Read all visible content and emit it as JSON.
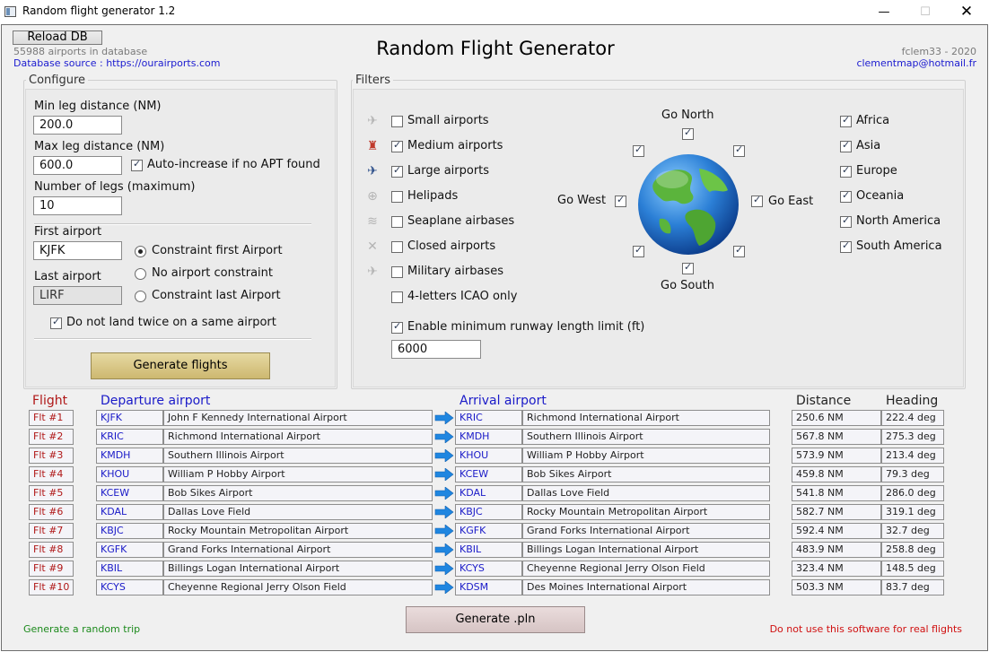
{
  "window": {
    "title": "Random flight generator 1.2",
    "minimize": "—",
    "maximize": "☐",
    "close": "✕"
  },
  "header": {
    "reload_label": "Reload DB",
    "airports_count": "55988 airports in database",
    "db_source": "Database source : https://ourairports.com",
    "app_title": "Random Flight Generator",
    "author": "fclem33 - 2020",
    "email": "clementmap@hotmail.fr"
  },
  "configure": {
    "title": "Configure",
    "min_leg_label": "Min leg distance (NM)",
    "min_leg_value": "200.0",
    "max_leg_label": "Max leg distance (NM)",
    "max_leg_value": "600.0",
    "auto_increase_label": "Auto-increase if no APT found",
    "legs_label": "Number of legs (maximum)",
    "legs_value": "10",
    "first_airport_label": "First airport",
    "first_airport_value": "KJFK",
    "last_airport_label": "Last airport",
    "last_airport_value": "LIRF",
    "radio_first": "Constraint first Airport",
    "radio_none": "No airport constraint",
    "radio_last": "Constraint last Airport",
    "no_twice_label": "Do not land twice on a same airport",
    "generate_label": "Generate flights"
  },
  "filters": {
    "title": "Filters",
    "types": [
      {
        "label": "Small airports",
        "checked": false,
        "icon": "small-airport-icon"
      },
      {
        "label": "Medium airports",
        "checked": true,
        "icon": "medium-airport-icon"
      },
      {
        "label": "Large airports",
        "checked": true,
        "icon": "large-airport-icon"
      },
      {
        "label": "Helipads",
        "checked": false,
        "icon": "helipad-icon"
      },
      {
        "label": "Seaplane airbases",
        "checked": false,
        "icon": "seaplane-icon"
      },
      {
        "label": "Closed airports",
        "checked": false,
        "icon": "closed-icon"
      },
      {
        "label": "Military airbases",
        "checked": false,
        "icon": "military-icon"
      }
    ],
    "icao_label": "4-letters ICAO only",
    "runway_label": "Enable minimum runway length limit (ft)",
    "runway_value": "6000",
    "go_north": "Go North",
    "go_south": "Go South",
    "go_east": "Go East",
    "go_west": "Go West",
    "continents": [
      {
        "label": "Africa",
        "checked": true
      },
      {
        "label": "Asia",
        "checked": true
      },
      {
        "label": "Europe",
        "checked": true
      },
      {
        "label": "Oceania",
        "checked": true
      },
      {
        "label": "North America",
        "checked": true
      },
      {
        "label": "South America",
        "checked": true
      }
    ]
  },
  "table": {
    "col_flight": "Flight",
    "col_departure": "Departure airport",
    "col_arrival": "Arrival airport",
    "col_distance": "Distance",
    "col_heading": "Heading",
    "rows": [
      {
        "flt": "Flt #1",
        "dep_icao": "KJFK",
        "dep_name": "John F Kennedy International Airport",
        "arr_icao": "KRIC",
        "arr_name": "Richmond International Airport",
        "distance": "250.6 NM",
        "heading": "222.4 deg"
      },
      {
        "flt": "Flt #2",
        "dep_icao": "KRIC",
        "dep_name": "Richmond International Airport",
        "arr_icao": "KMDH",
        "arr_name": "Southern Illinois Airport",
        "distance": "567.8 NM",
        "heading": "275.3 deg"
      },
      {
        "flt": "Flt #3",
        "dep_icao": "KMDH",
        "dep_name": "Southern Illinois Airport",
        "arr_icao": "KHOU",
        "arr_name": "William P Hobby Airport",
        "distance": "573.9 NM",
        "heading": "213.4 deg"
      },
      {
        "flt": "Flt #4",
        "dep_icao": "KHOU",
        "dep_name": "William P Hobby Airport",
        "arr_icao": "KCEW",
        "arr_name": "Bob Sikes Airport",
        "distance": "459.8 NM",
        "heading": "79.3 deg"
      },
      {
        "flt": "Flt #5",
        "dep_icao": "KCEW",
        "dep_name": "Bob Sikes Airport",
        "arr_icao": "KDAL",
        "arr_name": "Dallas Love Field",
        "distance": "541.8 NM",
        "heading": "286.0 deg"
      },
      {
        "flt": "Flt #6",
        "dep_icao": "KDAL",
        "dep_name": "Dallas Love Field",
        "arr_icao": "KBJC",
        "arr_name": "Rocky Mountain Metropolitan Airport",
        "distance": "582.7 NM",
        "heading": "319.1 deg"
      },
      {
        "flt": "Flt #7",
        "dep_icao": "KBJC",
        "dep_name": "Rocky Mountain Metropolitan Airport",
        "arr_icao": "KGFK",
        "arr_name": "Grand Forks International Airport",
        "distance": "592.4 NM",
        "heading": "32.7 deg"
      },
      {
        "flt": "Flt #8",
        "dep_icao": "KGFK",
        "dep_name": "Grand Forks International Airport",
        "arr_icao": "KBIL",
        "arr_name": "Billings Logan International Airport",
        "distance": "483.9 NM",
        "heading": "258.8 deg"
      },
      {
        "flt": "Flt #9",
        "dep_icao": "KBIL",
        "dep_name": "Billings Logan International Airport",
        "arr_icao": "KCYS",
        "arr_name": "Cheyenne Regional Jerry Olson Field",
        "distance": "323.4 NM",
        "heading": "148.5 deg"
      },
      {
        "flt": "Flt #10",
        "dep_icao": "KCYS",
        "dep_name": "Cheyenne Regional Jerry Olson Field",
        "arr_icao": "KDSM",
        "arr_name": "Des Moines International Airport",
        "distance": "503.3 NM",
        "heading": "83.7 deg"
      }
    ]
  },
  "footer": {
    "generate_pln_label": "Generate .pln",
    "left_note": "Generate a random trip",
    "right_note": "Do not use this software for real flights"
  },
  "colors": {
    "flight_red": "#b01818",
    "icao_blue": "#1a1ac8",
    "link_blue": "#1b1bd0",
    "note_green": "#1c8a1c",
    "note_red": "#d01010",
    "generate_gold": "#d8c88a",
    "pln_pink": "#e2d2d2"
  }
}
